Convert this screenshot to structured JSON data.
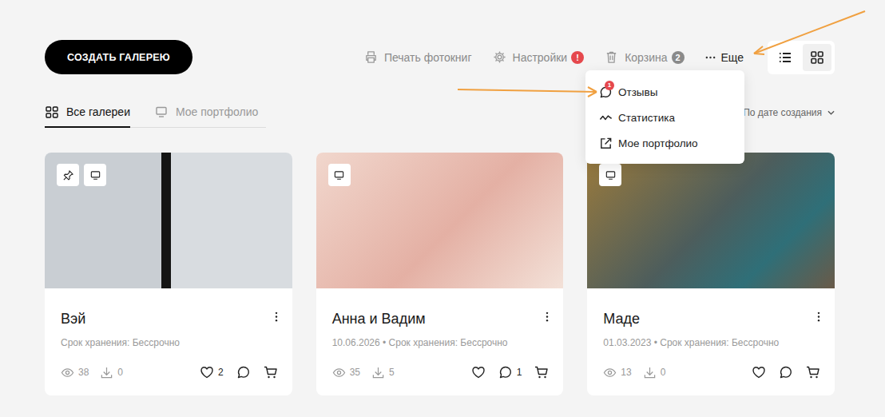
{
  "create_button": "СОЗДАТЬ ГАЛЕРЕЮ",
  "toolbar": [
    {
      "kind": "print",
      "label": "Печать фотокниг"
    },
    {
      "kind": "settings",
      "label": "Настройки",
      "badge": "!",
      "badge_color": "#e5484d"
    },
    {
      "kind": "trash",
      "label": "Корзина",
      "badge": "2",
      "badge_color": "#8a8a8a"
    }
  ],
  "more": {
    "label": "Еще",
    "expanded": true
  },
  "views": [
    {
      "kind": "list",
      "selected": false
    },
    {
      "kind": "grid",
      "selected": true
    }
  ],
  "menu": [
    {
      "kind": "reviews",
      "label": "Отзывы",
      "badge": "1"
    },
    {
      "kind": "stats",
      "label": "Статистика"
    },
    {
      "kind": "external",
      "label": "Мое портфолио"
    }
  ],
  "tabs": [
    {
      "kind": "grid",
      "label": "Все галереи",
      "selected": true
    },
    {
      "kind": "monitor",
      "label": "Мое портфолио",
      "selected": false
    }
  ],
  "sort": {
    "label": "По дате создания"
  },
  "galleries": [
    {
      "title": "Вэй",
      "meta": "Срок хранения: Бессрочно",
      "pinned": true,
      "in_portfolio": true,
      "views": "38",
      "downloads": "0",
      "likes": "2",
      "comments": ""
    },
    {
      "title": "Анна и Вадим",
      "meta": "10.06.2026 • Срок хранения: Бессрочно",
      "pinned": false,
      "in_portfolio": true,
      "views": "35",
      "downloads": "5",
      "likes": "",
      "comments": "1"
    },
    {
      "title": "Маде",
      "meta": "01.03.2023 • Срок хранения: Бессрочно",
      "pinned": false,
      "in_portfolio": true,
      "views": "13",
      "downloads": "0",
      "likes": "",
      "comments": ""
    }
  ]
}
